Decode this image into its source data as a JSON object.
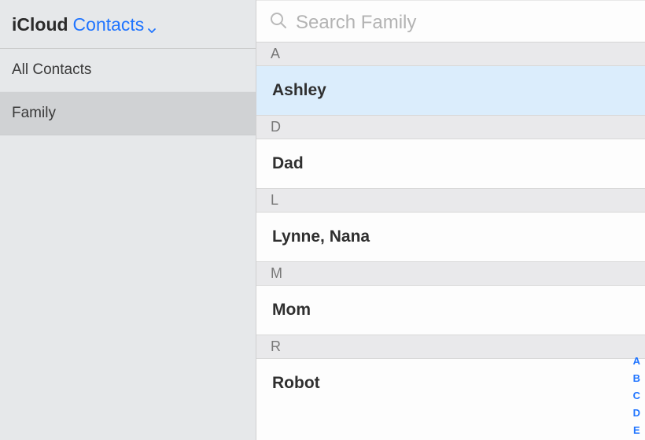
{
  "header": {
    "brand": "iCloud",
    "app": "Contacts"
  },
  "sidebar": {
    "items": [
      {
        "label": "All Contacts",
        "selected": false
      },
      {
        "label": "Family",
        "selected": true
      }
    ]
  },
  "search": {
    "placeholder": "Search Family",
    "value": ""
  },
  "sections": [
    {
      "letter": "A",
      "contacts": [
        {
          "name": "Ashley",
          "selected": true
        }
      ]
    },
    {
      "letter": "D",
      "contacts": [
        {
          "name": "Dad",
          "selected": false
        }
      ]
    },
    {
      "letter": "L",
      "contacts": [
        {
          "name": "Lynne, Nana",
          "selected": false
        }
      ]
    },
    {
      "letter": "M",
      "contacts": [
        {
          "name": "Mom",
          "selected": false
        }
      ]
    },
    {
      "letter": "R",
      "contacts": [
        {
          "name": "Robot",
          "selected": false
        }
      ]
    }
  ],
  "alpha_index": [
    "A",
    "B",
    "C",
    "D",
    "E"
  ]
}
